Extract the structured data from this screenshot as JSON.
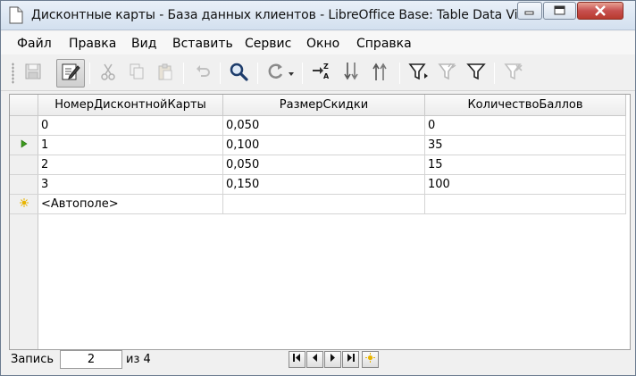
{
  "window": {
    "title": "Дисконтные карты - База данных клиентов - LibreOffice Base: Table Data View"
  },
  "menu": {
    "items": [
      "Файл",
      "Правка",
      "Вид",
      "Вставить",
      "Сервис",
      "Окно",
      "Справка"
    ]
  },
  "toolbar": {
    "buttons": [
      {
        "icon": "save-icon",
        "enabled": false
      },
      {
        "icon": "edit-data-icon",
        "enabled": true,
        "active": true
      },
      {
        "icon": "cut-icon",
        "enabled": false
      },
      {
        "icon": "copy-icon",
        "enabled": false
      },
      {
        "icon": "paste-icon",
        "enabled": false
      },
      {
        "icon": "undo-icon",
        "enabled": false
      },
      {
        "icon": "find-record-icon",
        "enabled": true
      },
      {
        "icon": "refresh-icon",
        "enabled": true
      },
      {
        "icon": "sort-icon",
        "enabled": true
      },
      {
        "icon": "sort-ascending-icon",
        "enabled": true
      },
      {
        "icon": "sort-descending-icon",
        "enabled": true
      },
      {
        "icon": "autofilter-icon",
        "enabled": true
      },
      {
        "icon": "apply-filter-icon",
        "enabled": false
      },
      {
        "icon": "standard-filter-icon",
        "enabled": true
      },
      {
        "icon": "reset-filter-icon",
        "enabled": false
      }
    ]
  },
  "table": {
    "columns": [
      "НомерДисконтнойКарты",
      "РазмерСкидки",
      "КоличествоБаллов"
    ],
    "rows": [
      [
        "0",
        "0,050",
        "0"
      ],
      [
        "1",
        "0,100",
        "35"
      ],
      [
        "2",
        "0,050",
        "15"
      ],
      [
        "3",
        "0,150",
        "100"
      ]
    ],
    "current_row": 1,
    "new_row_placeholder": "<Автополе>"
  },
  "navigation": {
    "record_label": "Запись",
    "record_value": "2",
    "of_label": "из 4"
  },
  "colors": {
    "title_gradient_top": "#e9f0f8",
    "close_button": "#c75050",
    "current_row_marker": "#3c9a1c",
    "new_row_marker": "#e8b400"
  }
}
